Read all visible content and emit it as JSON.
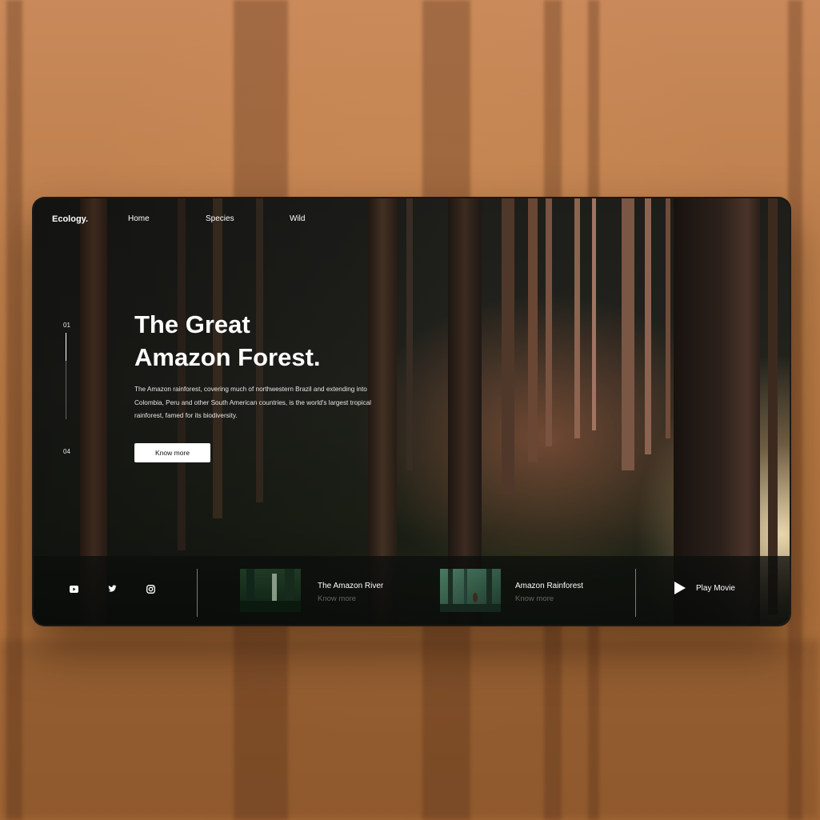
{
  "brand": {
    "logo": "Ecology."
  },
  "nav": {
    "items": [
      "Home",
      "Species",
      "Wild"
    ]
  },
  "slider": {
    "current": "01",
    "total": "04"
  },
  "hero": {
    "title_line1": "The Great",
    "title_line2": "Amazon Forest.",
    "description": "The Amazon rainforest, covering much of northwestern Brazil and extending into Colombia, Peru and other South American countries, is the world's largest tropical rainforest, famed for its biodiversity.",
    "cta_label": "Know more"
  },
  "social": {
    "icons": [
      "youtube-icon",
      "twitter-icon",
      "instagram-icon"
    ]
  },
  "cards": [
    {
      "title": "The Amazon River",
      "link": "Know more"
    },
    {
      "title": "Amazon Rainforest",
      "link": "Know more"
    }
  ],
  "play": {
    "label": "Play Movie"
  },
  "colors": {
    "accent": "#ffffff",
    "backdrop": "#b8743c",
    "frame": "#121512"
  }
}
